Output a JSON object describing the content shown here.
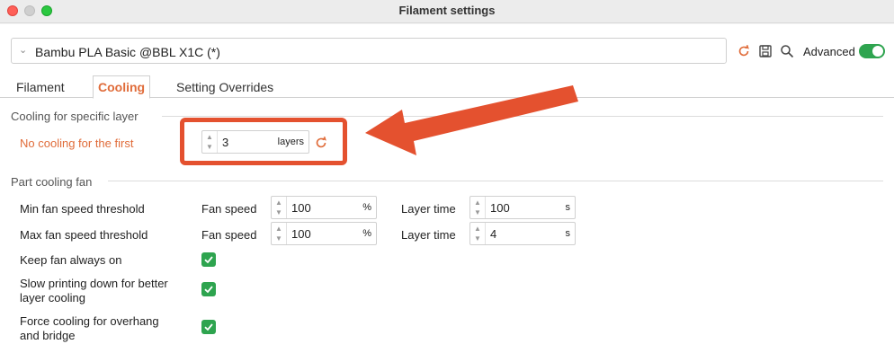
{
  "window": {
    "title": "Filament settings"
  },
  "preset": {
    "name": "Bambu PLA Basic @BBL X1C (*)"
  },
  "header": {
    "advanced_label": "Advanced",
    "advanced_on": true
  },
  "tabs": [
    {
      "label": "Filament",
      "active": false
    },
    {
      "label": "Cooling",
      "active": true
    },
    {
      "label": "Setting Overrides",
      "active": false
    }
  ],
  "cooling_layer": {
    "section_title": "Cooling for specific layer",
    "label": "No cooling for the first",
    "value": "3",
    "unit": "layers"
  },
  "part_cooling": {
    "section_title": "Part cooling fan",
    "rows": [
      {
        "label": "Min fan speed threshold",
        "fan_label": "Fan speed",
        "fan_value": "100",
        "fan_unit": "%",
        "time_label": "Layer time",
        "time_value": "100",
        "time_unit": "s"
      },
      {
        "label": "Max fan speed threshold",
        "fan_label": "Fan speed",
        "fan_value": "100",
        "fan_unit": "%",
        "time_label": "Layer time",
        "time_value": "4",
        "time_unit": "s"
      }
    ],
    "keep_fan_on": {
      "label": "Keep fan always on",
      "checked": true
    },
    "slow_down": {
      "label_line1": "Slow printing down for better",
      "label_line2": "layer cooling",
      "checked": true
    },
    "force_cooling": {
      "label_line1": "Force cooling for overhang",
      "label_line2": "and bridge",
      "checked": true
    }
  },
  "colors": {
    "accent": "#e06c3a",
    "highlight": "#e4512f",
    "toggle": "#2ea44f"
  }
}
